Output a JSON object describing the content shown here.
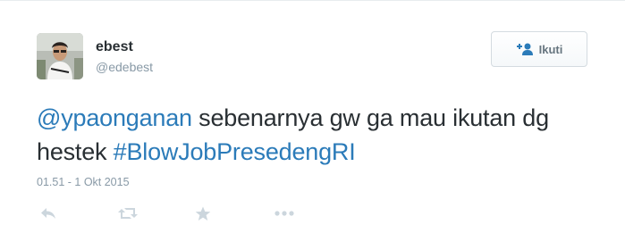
{
  "user": {
    "display_name": "ebest",
    "screen_name": "@edebest",
    "avatar_icon": "user-avatar"
  },
  "follow_button": {
    "label": "Ikuti",
    "icon": "add-user-icon"
  },
  "tweet": {
    "mention": "@ypaonganan",
    "text_part1": " sebenarnya gw ga mau ikutan dg hestek  ",
    "hashtag": "#BlowJobPresedengRI",
    "timestamp": "01.51 - 1 Okt 2015"
  },
  "actions": [
    {
      "name": "reply",
      "icon": "reply-icon"
    },
    {
      "name": "retweet",
      "icon": "retweet-icon"
    },
    {
      "name": "favorite",
      "icon": "star-icon"
    },
    {
      "name": "more",
      "icon": "more-icon"
    }
  ],
  "colors": {
    "link": "#2b7bb9",
    "text": "#292f33",
    "muted": "#8899a6",
    "icon": "#ccd6dd"
  }
}
